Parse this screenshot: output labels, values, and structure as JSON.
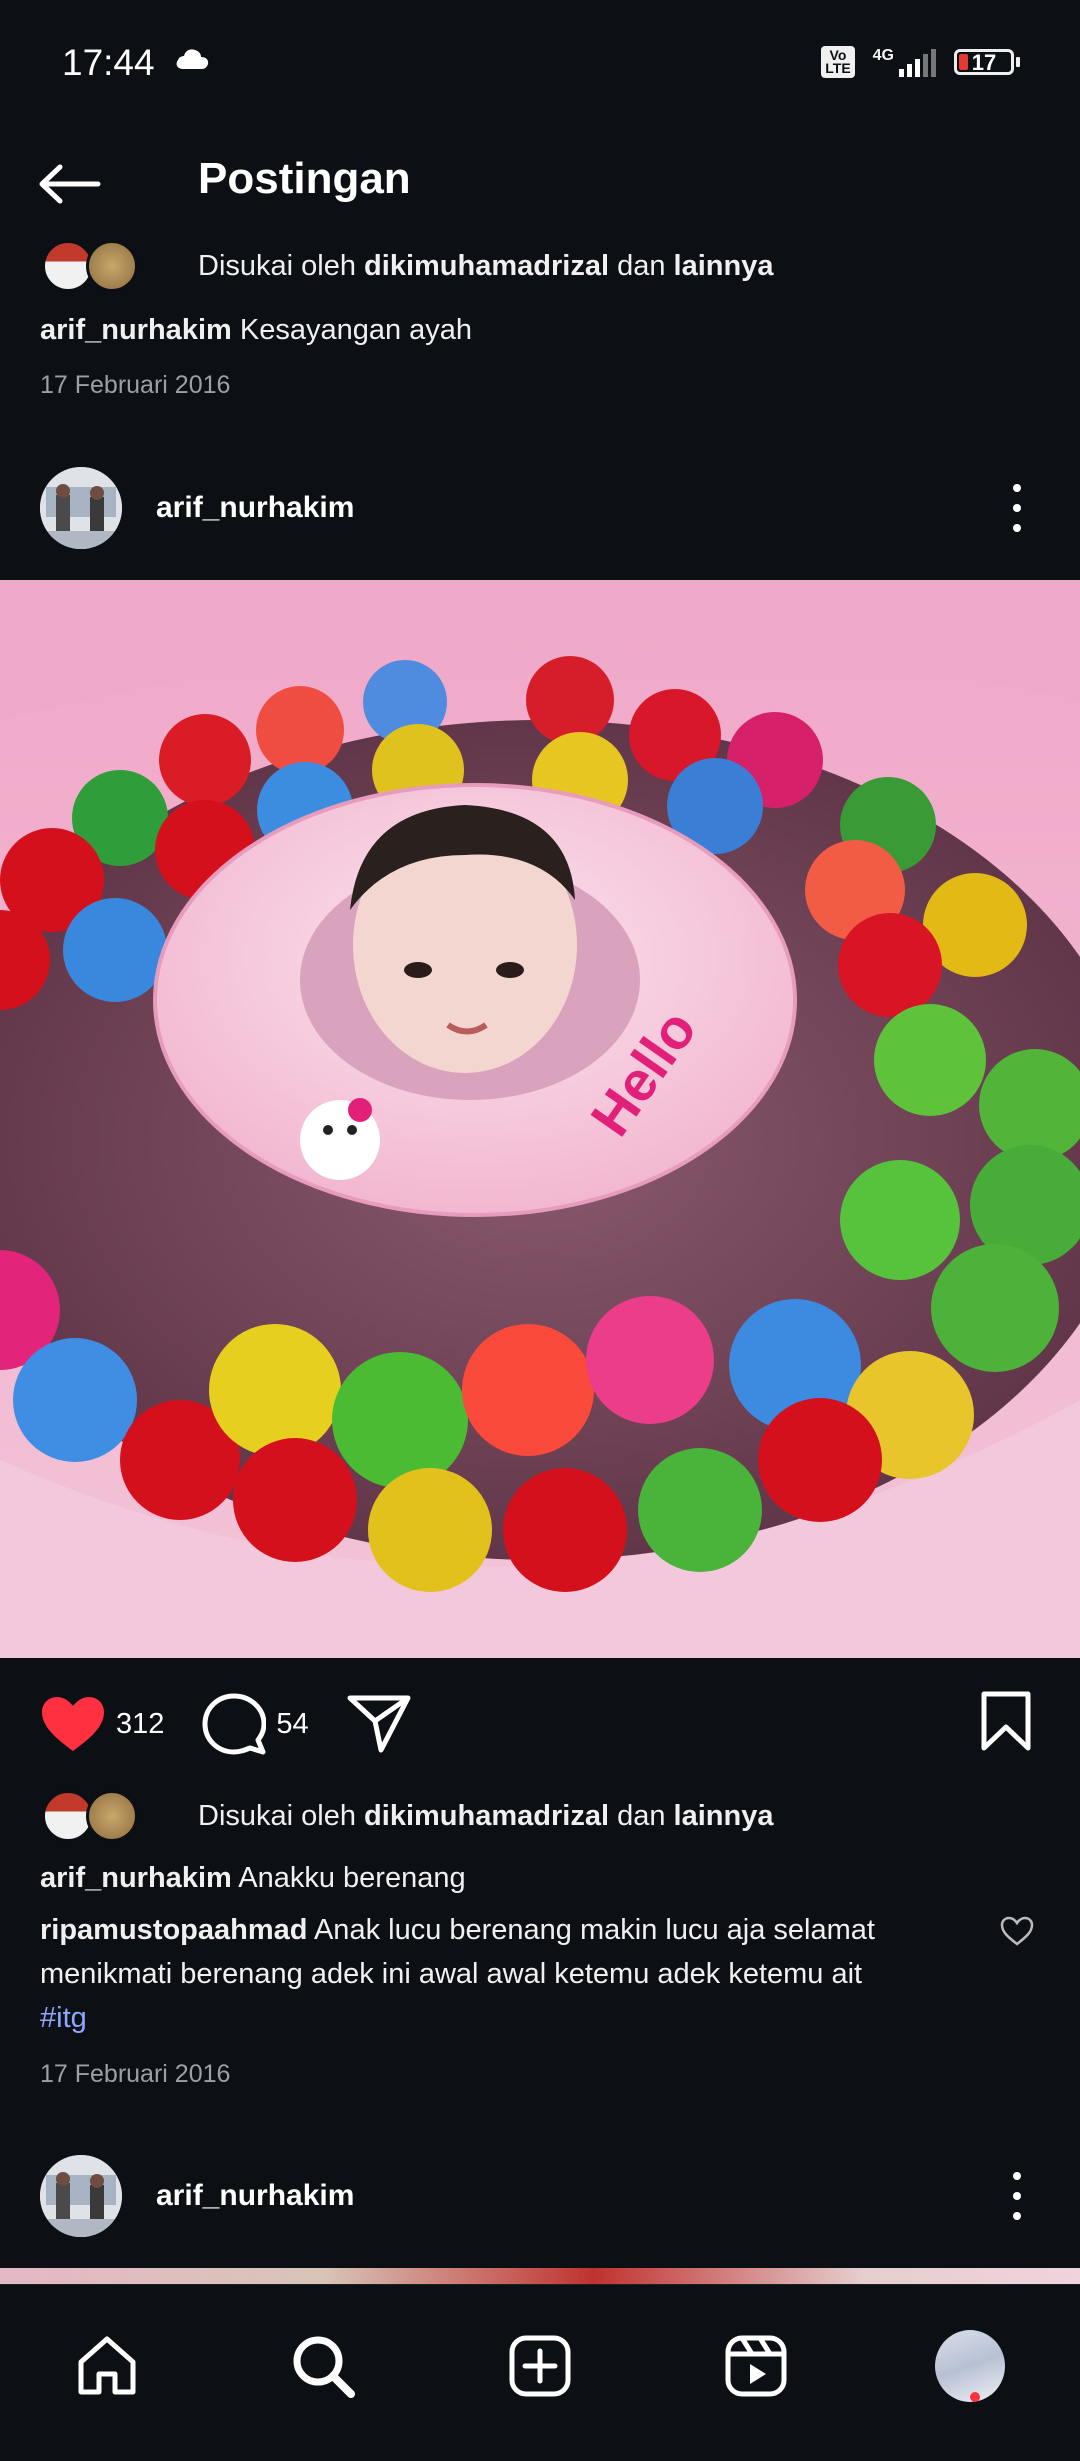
{
  "status_bar": {
    "time": "17:44",
    "network": "4G",
    "volte": "Vo LTE",
    "battery": "17",
    "battery_level_percent": 17,
    "weather_icon": "cloud-icon"
  },
  "header": {
    "title": "Postingan",
    "back_icon": "arrow-left-icon"
  },
  "posts": [
    {
      "likes_prefix": "Disukai oleh",
      "likes_user": "dikimuhamadrizal",
      "likes_and": "dan",
      "likes_others": "lainnya",
      "caption_user": "arif_nurhakim",
      "caption_text": "Kesayangan ayah",
      "date": "17 Februari 2016"
    },
    {
      "username": "arif_nurhakim",
      "likes_count": "312",
      "comments_count": "54",
      "likes_prefix": "Disukai oleh",
      "likes_user": "dikimuhamadrizal",
      "likes_and": "dan",
      "likes_others": "lainnya",
      "caption_user": "arif_nurhakim",
      "caption_text": "Anakku berenang",
      "comment_user": "ripamustopaahmad",
      "comment_text": "Anak lucu berenang makin lucu aja selamat menikmati berenang adek ini awal awal ketemu adek ketemu ait",
      "comment_hashtag": "#itg",
      "date": "17 Februari 2016"
    },
    {
      "username": "arif_nurhakim"
    }
  ],
  "bottom_nav": [
    "home-icon",
    "search-icon",
    "create-icon",
    "reels-icon",
    "profile-avatar"
  ],
  "colors": {
    "background": "#0c0f14",
    "like_red": "#ff3040",
    "hashtag": "#8ea6ff",
    "secondary_text": "#9aa0a6"
  }
}
